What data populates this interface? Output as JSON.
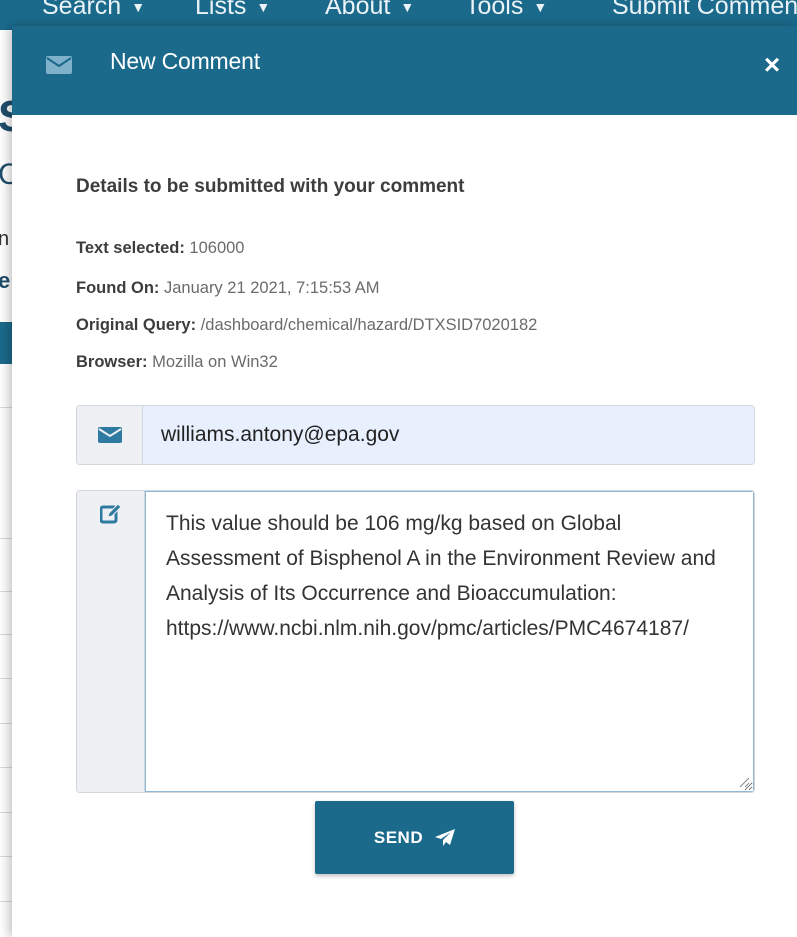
{
  "background_nav": {
    "items": [
      {
        "label": "Search"
      },
      {
        "label": "Lists"
      },
      {
        "label": "About"
      },
      {
        "label": "Tools"
      },
      {
        "label": "Submit Comments"
      }
    ]
  },
  "modal": {
    "title": "New Comment",
    "header_icon": "envelope-icon",
    "close_label": "×",
    "details_heading": "Details to be submitted with your comment",
    "details": [
      {
        "key": "Text selected:",
        "value": "106000"
      },
      {
        "key": "Found On:",
        "value": "January 21 2021, 7:15:53 AM"
      },
      {
        "key": "Original Query:",
        "value": "/dashboard/chemical/hazard/DTXSID7020182"
      },
      {
        "key": "Browser:",
        "value": "Mozilla on Win32"
      }
    ],
    "email": {
      "icon": "envelope-icon",
      "value": "williams.antony@epa.gov"
    },
    "comment": {
      "icon": "edit-icon",
      "value": "This value should be 106 mg/kg based on Global Assessment of Bisphenol A in the Environment Review and Analysis of Its Occurrence and Bioaccumulation: https://www.ncbi.nlm.nih.gov/pmc/articles/PMC4674187/"
    },
    "send_button": {
      "label": "SEND",
      "icon": "paper-plane-icon"
    }
  },
  "colors": {
    "primary": "#1b6a8c",
    "addon_bg": "#eef0f3",
    "autofill_bg": "#e8f0fe"
  }
}
